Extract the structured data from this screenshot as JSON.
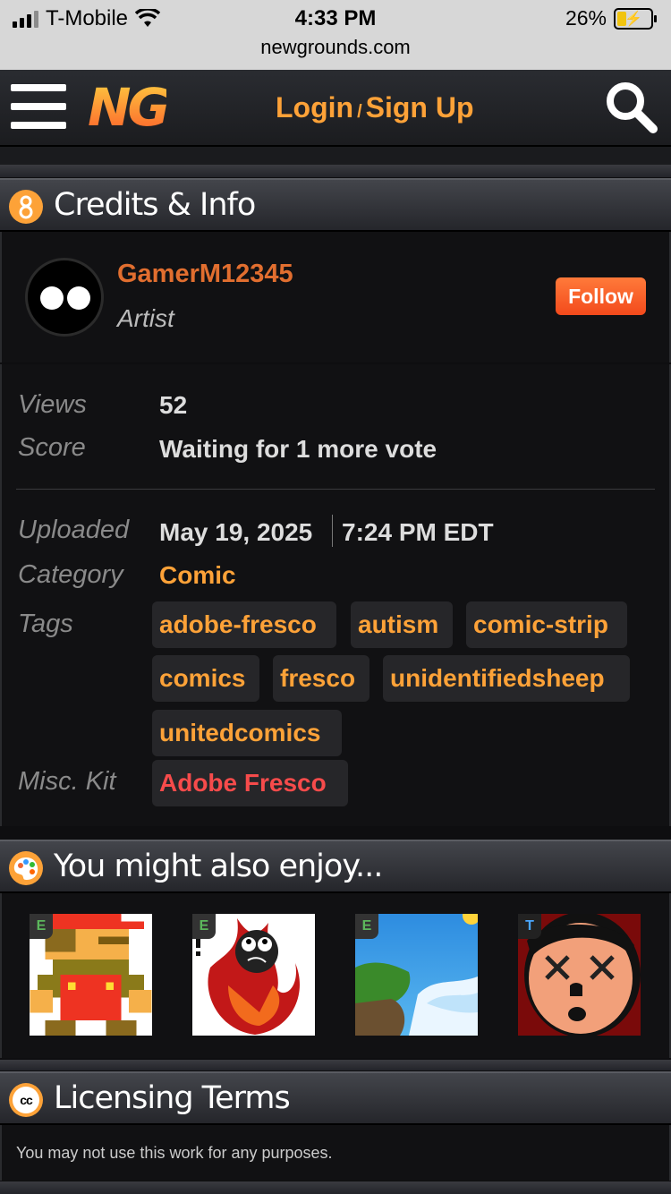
{
  "status_bar": {
    "carrier": "T-Mobile",
    "time": "4:33 PM",
    "url": "newgrounds.com",
    "battery": "26%"
  },
  "header": {
    "logo": "NG",
    "login": "Login",
    "signup": "Sign Up"
  },
  "credits": {
    "title": "Credits & Info",
    "username": "GamerM12345",
    "role": "Artist",
    "follow_label": "Follow"
  },
  "stats": {
    "views_label": "Views",
    "views": "52",
    "score_label": "Score",
    "score": "Waiting for 1 more vote",
    "uploaded_label": "Uploaded",
    "uploaded_date": "May 19, 2025",
    "uploaded_time": "7:24 PM EDT",
    "category_label": "Category",
    "category": "Comic",
    "tags_label": "Tags",
    "tags": [
      "adobe-fresco",
      "autism",
      "comic-strip",
      "comics",
      "fresco",
      "unidentifiedsheep",
      "unitedcomics"
    ],
    "misc_label": "Misc. Kit",
    "misc": "Adobe Fresco"
  },
  "enjoy": {
    "title": "You might also enjoy...",
    "items": [
      {
        "rating": "E",
        "thumb": "pixel-mario"
      },
      {
        "rating": "E",
        "thumb": "fire-character"
      },
      {
        "rating": "E",
        "thumb": "sky-landscape"
      },
      {
        "rating": "T",
        "thumb": "cartoon-face"
      }
    ]
  },
  "licensing": {
    "title": "Licensing Terms",
    "text": "You may not use this work for any purposes."
  },
  "colors": {
    "accent": "#fda238",
    "follow": "#f34a1c",
    "username": "#e16e2f",
    "misc": "#f64b4b"
  }
}
